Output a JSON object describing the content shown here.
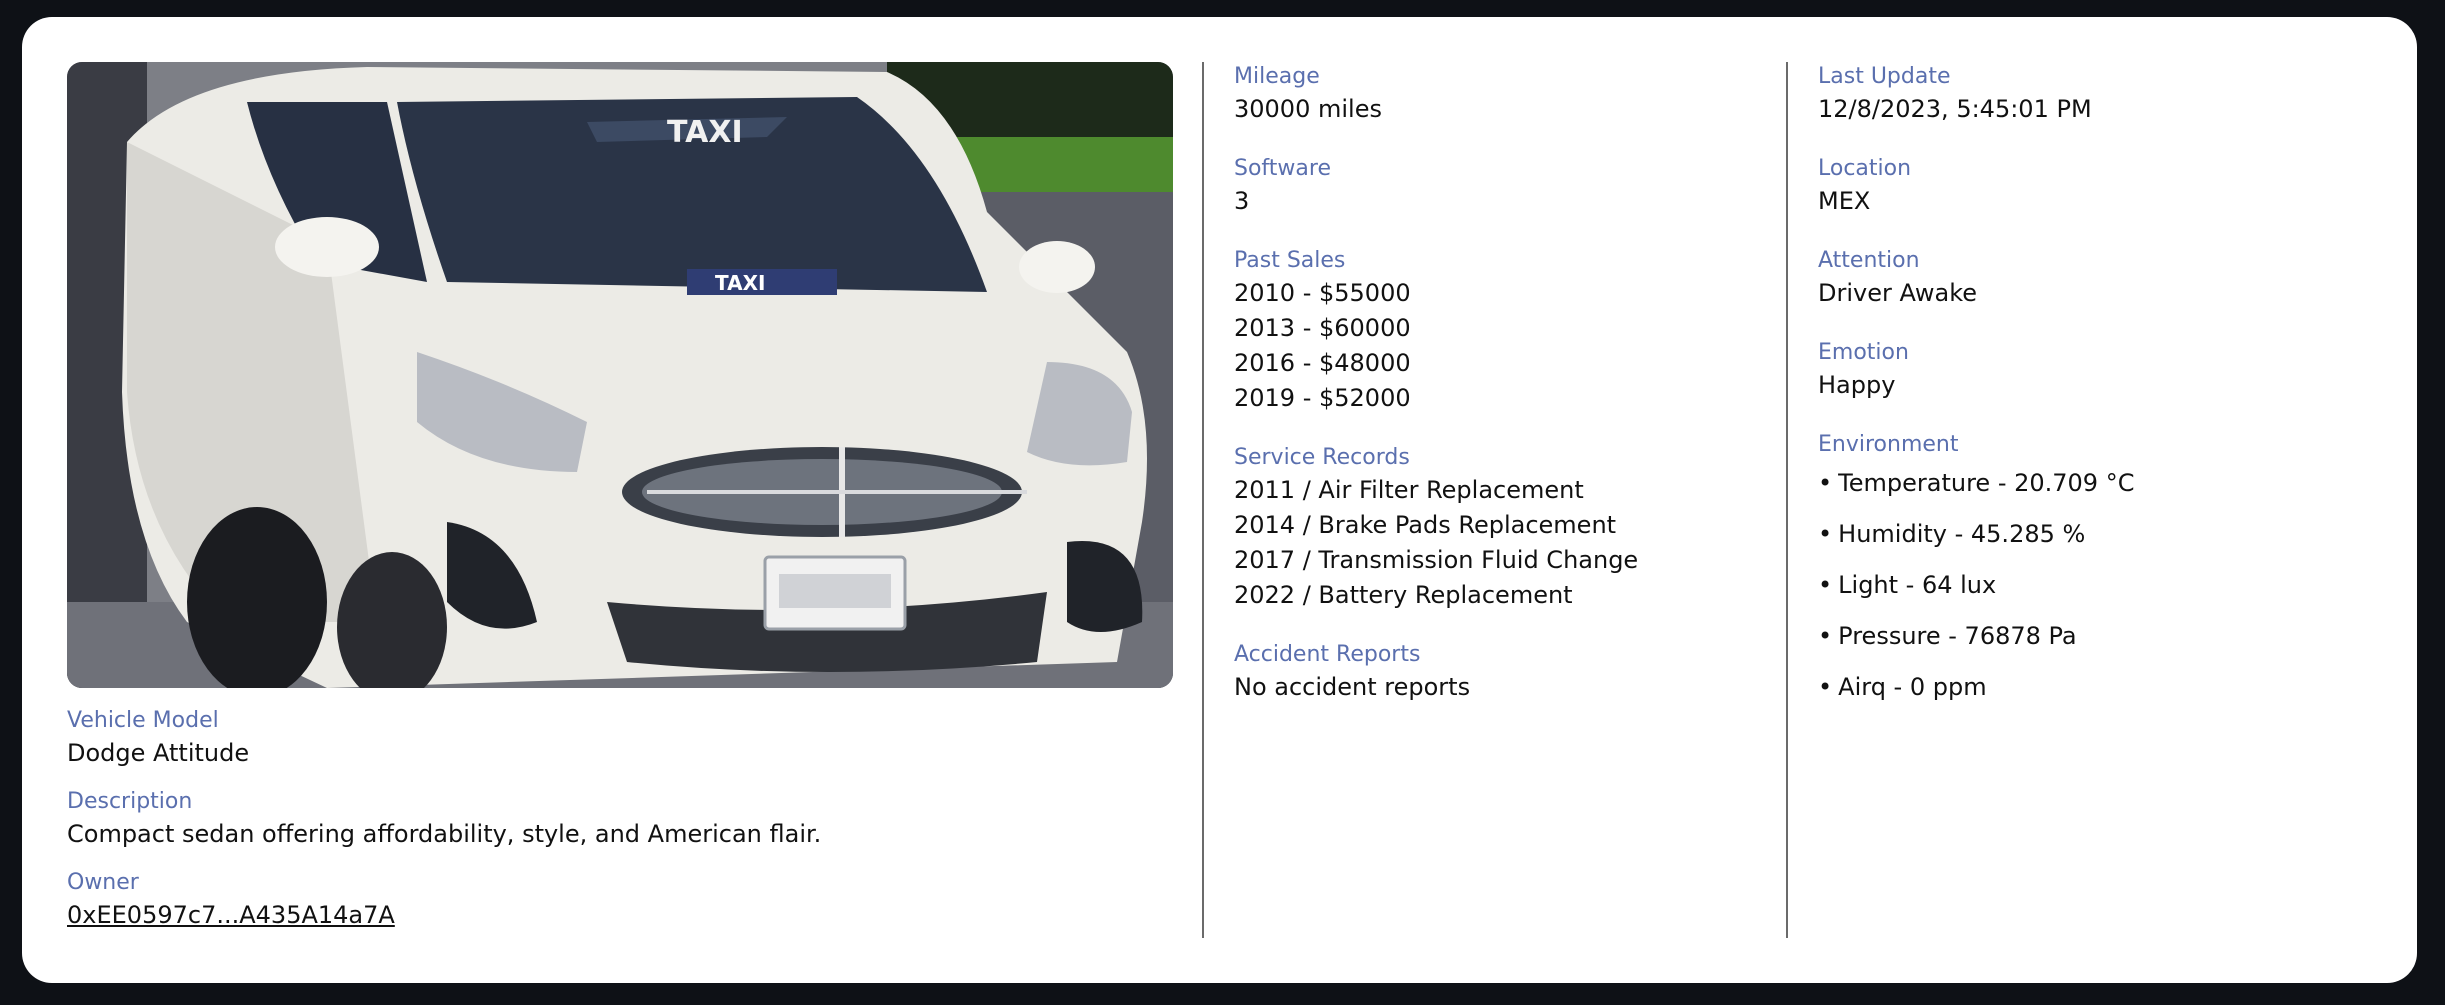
{
  "vehicle": {
    "model_label": "Vehicle Model",
    "model": "Dodge Attitude",
    "description_label": "Description",
    "description": "Compact sedan offering affordability, style, and American flair.",
    "owner_label": "Owner",
    "owner": "0xEE0597c7...A435A14a7A",
    "photo_plate_text": "TAXI",
    "photo_sign_text": "TAXI"
  },
  "history": {
    "mileage_label": "Mileage",
    "mileage": "30000 miles",
    "software_label": "Software",
    "software": "3",
    "past_sales_label": "Past Sales",
    "past_sales": [
      "2010 - $55000",
      "2013 - $60000",
      "2016 - $48000",
      "2019 - $52000"
    ],
    "service_label": "Service Records",
    "service_records": [
      "2011 / Air Filter Replacement",
      "2014 / Brake Pads Replacement",
      "2017 / Transmission Fluid Change",
      "2022 / Battery Replacement"
    ],
    "accident_label": "Accident Reports",
    "accident": "No accident reports"
  },
  "status": {
    "last_update_label": "Last Update",
    "last_update": "12/8/2023, 5:45:01 PM",
    "location_label": "Location",
    "location": "MEX",
    "attention_label": "Attention",
    "attention": "Driver Awake",
    "emotion_label": "Emotion",
    "emotion": "Happy",
    "environment_label": "Environment",
    "environment": [
      "Temperature - 20.709 °C",
      "Humidity - 45.285 %",
      "Light - 64 lux",
      "Pressure - 76878 Pa",
      "Airq - 0 ppm"
    ]
  },
  "colors": {
    "label": "#5a6fae",
    "text": "#111111",
    "background": "#0e1116",
    "card": "#ffffff"
  }
}
